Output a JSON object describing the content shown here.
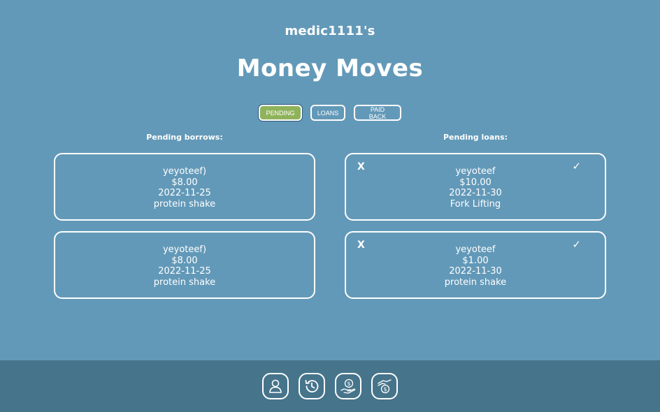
{
  "header": {
    "username": "medic1111's",
    "title": "Money Moves"
  },
  "tabs": [
    {
      "label": "PENDING",
      "active": true
    },
    {
      "label": "LOANS",
      "active": false
    },
    {
      "label": "PAID BACK",
      "active": false
    }
  ],
  "borrows": {
    "heading": "Pending borrows:",
    "items": [
      {
        "name": "yeyoteef)",
        "amount": "$8.00",
        "date": "2022-11-25",
        "note": "protein shake"
      },
      {
        "name": "yeyoteef)",
        "amount": "$8.00",
        "date": "2022-11-25",
        "note": "protein shake"
      }
    ]
  },
  "loans": {
    "heading": "Pending loans:",
    "items": [
      {
        "reject": "X",
        "accept": "✓",
        "name": "yeyoteef",
        "amount": "$10.00",
        "date": "2022-11-30",
        "note": "Fork Lifting"
      },
      {
        "reject": "X",
        "accept": "✓",
        "name": "yeyoteef",
        "amount": "$1.00",
        "date": "2022-11-30",
        "note": "protein shake"
      }
    ]
  },
  "footer": {
    "icons": [
      "user-icon",
      "history-icon",
      "hand-coin-icon",
      "coin-exchange-icon"
    ]
  },
  "colors": {
    "background": "#6399b8",
    "footer": "#46748b",
    "active_tab": "#8fb35a"
  }
}
